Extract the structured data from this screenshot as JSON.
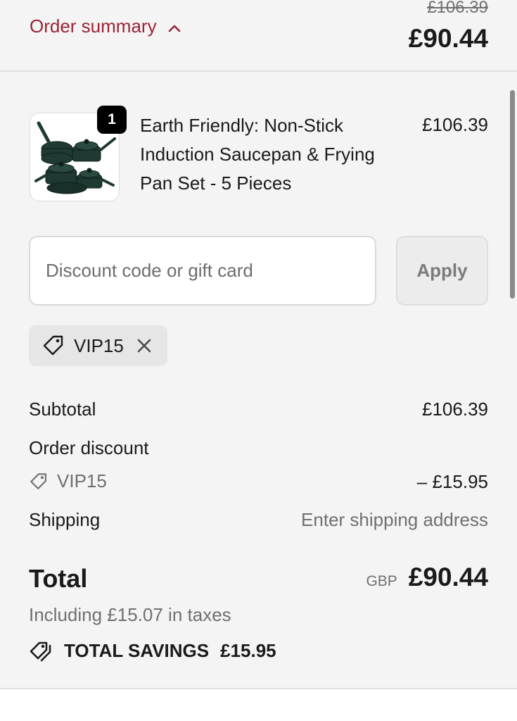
{
  "header": {
    "toggle_label": "Order summary",
    "original_total": "£106.39",
    "total": "£90.44"
  },
  "product": {
    "quantity": "1",
    "name": "Earth Friendly: Non-Stick Induction Saucepan & Frying Pan Set - 5 Pieces",
    "price": "£106.39",
    "image": "cookware-set"
  },
  "discount": {
    "placeholder": "Discount code or gift card",
    "apply_label": "Apply",
    "applied_code": "VIP15"
  },
  "breakdown": {
    "subtotal_label": "Subtotal",
    "subtotal_value": "£106.39",
    "order_discount_label": "Order discount",
    "discount_code": "VIP15",
    "discount_value": "– £15.95",
    "shipping_label": "Shipping",
    "shipping_value": "Enter shipping address"
  },
  "total": {
    "label": "Total",
    "currency": "GBP",
    "value": "£90.44",
    "taxes_note": "Including £15.07 in taxes",
    "savings_label": "TOTAL SAVINGS",
    "savings_value": "£15.95"
  },
  "colors": {
    "accent": "#9b2335",
    "panel_bg": "#f4f4f4",
    "muted_text": "#707070"
  },
  "icons": [
    "chevron-up-icon",
    "tag-icon",
    "close-icon",
    "double-tag-icon"
  ]
}
